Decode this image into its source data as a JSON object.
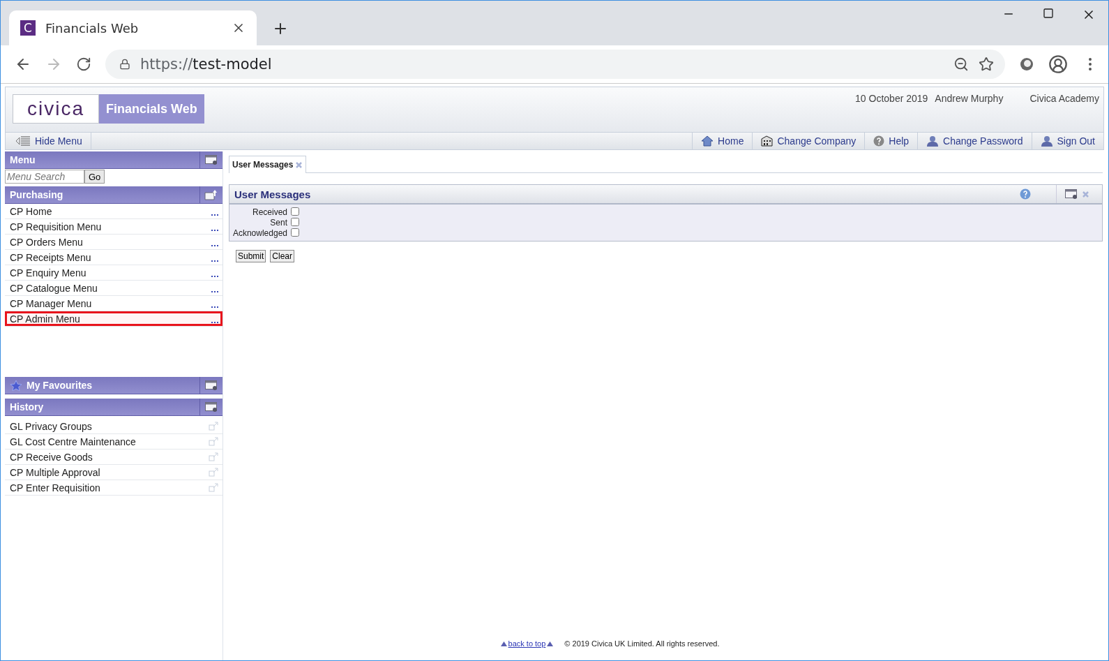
{
  "browser": {
    "favicon_letter": "C",
    "tab_title": "Financials Web",
    "url_scheme": "https://",
    "url_host": "test-model"
  },
  "header": {
    "logo": "civica",
    "product": "Financials Web",
    "date": "10 October 2019",
    "user": "Andrew Murphy",
    "company": "Civica Academy"
  },
  "nav": {
    "hide_menu": "Hide Menu",
    "links": [
      {
        "label": "Home",
        "kind": "home"
      },
      {
        "label": "Change Company",
        "kind": "company"
      },
      {
        "label": "Help",
        "kind": "help"
      },
      {
        "label": "Change Password",
        "kind": "user"
      },
      {
        "label": "Sign Out",
        "kind": "user"
      }
    ]
  },
  "sidebar": {
    "menu_title": "Menu",
    "search_placeholder": "Menu Search",
    "go": "Go",
    "section_title": "Purchasing",
    "items": [
      {
        "label": "CP Home",
        "highlighted": false
      },
      {
        "label": "CP Requisition Menu",
        "highlighted": false
      },
      {
        "label": "CP Orders Menu",
        "highlighted": false
      },
      {
        "label": "CP Receipts Menu",
        "highlighted": false
      },
      {
        "label": "CP Enquiry Menu",
        "highlighted": false
      },
      {
        "label": "CP Catalogue Menu",
        "highlighted": false
      },
      {
        "label": "CP Manager Menu",
        "highlighted": false
      },
      {
        "label": "CP Admin Menu",
        "highlighted": true
      }
    ],
    "favourites_title": "My Favourites",
    "history_title": "History",
    "history": [
      "GL Privacy Groups",
      "GL Cost Centre Maintenance",
      "CP Receive Goods",
      "CP Multiple Approval",
      "CP Enter Requisition"
    ]
  },
  "tabs": [
    {
      "label": "User Messages",
      "selected": true
    }
  ],
  "panel": {
    "title": "User Messages",
    "filters": [
      {
        "label": "Received",
        "checked": false
      },
      {
        "label": "Sent",
        "checked": false
      },
      {
        "label": "Acknowledged",
        "checked": false
      }
    ],
    "buttons": [
      "Submit",
      "Clear"
    ]
  },
  "footer": {
    "back_to_top": "back to top",
    "copyright": "© 2019 Civica UK Limited. All rights reserved."
  }
}
